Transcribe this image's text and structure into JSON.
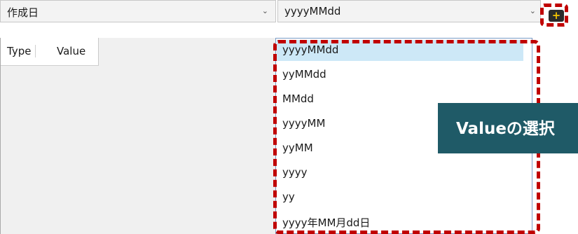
{
  "field_select": {
    "value": "作成日"
  },
  "format_select": {
    "value": "yyyyMMdd"
  },
  "grid": {
    "columns": [
      "Type",
      "Value"
    ]
  },
  "dropdown": {
    "options": [
      "yyyyMMdd",
      "yyMMdd",
      "MMdd",
      "yyyyMM",
      "yyMM",
      "yyyy",
      "yy",
      "yyyy年MM月dd日"
    ],
    "selected": "yyyyMMdd"
  },
  "add_button": {
    "icon": "plus-icon",
    "glyph": "+"
  },
  "callout": {
    "text": "Valueの選択"
  },
  "colors": {
    "highlight_border": "#c00000",
    "callout_bg": "#1f5a67",
    "selected_bg": "#cde8f7",
    "add_icon": "#f4c400"
  }
}
